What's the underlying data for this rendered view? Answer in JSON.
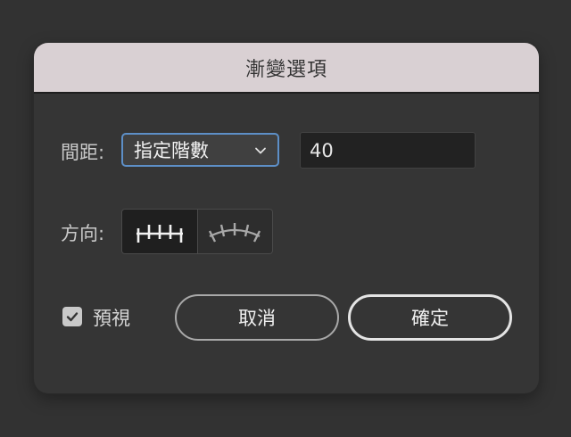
{
  "dialog": {
    "title": "漸變選項",
    "spacing": {
      "label": "間距:",
      "selected_option": "指定階數",
      "value": "40"
    },
    "orientation": {
      "label": "方向:",
      "options": [
        {
          "icon": "align-to-page-icon",
          "selected": true
        },
        {
          "icon": "align-to-path-icon",
          "selected": false
        }
      ]
    },
    "preview": {
      "label": "預視",
      "checked": true
    },
    "buttons": {
      "cancel_label": "取消",
      "ok_label": "確定"
    }
  },
  "colors": {
    "accent": "#5d8fc7",
    "titlebar": "#d9d0d3",
    "dialog_bg": "#353535"
  }
}
